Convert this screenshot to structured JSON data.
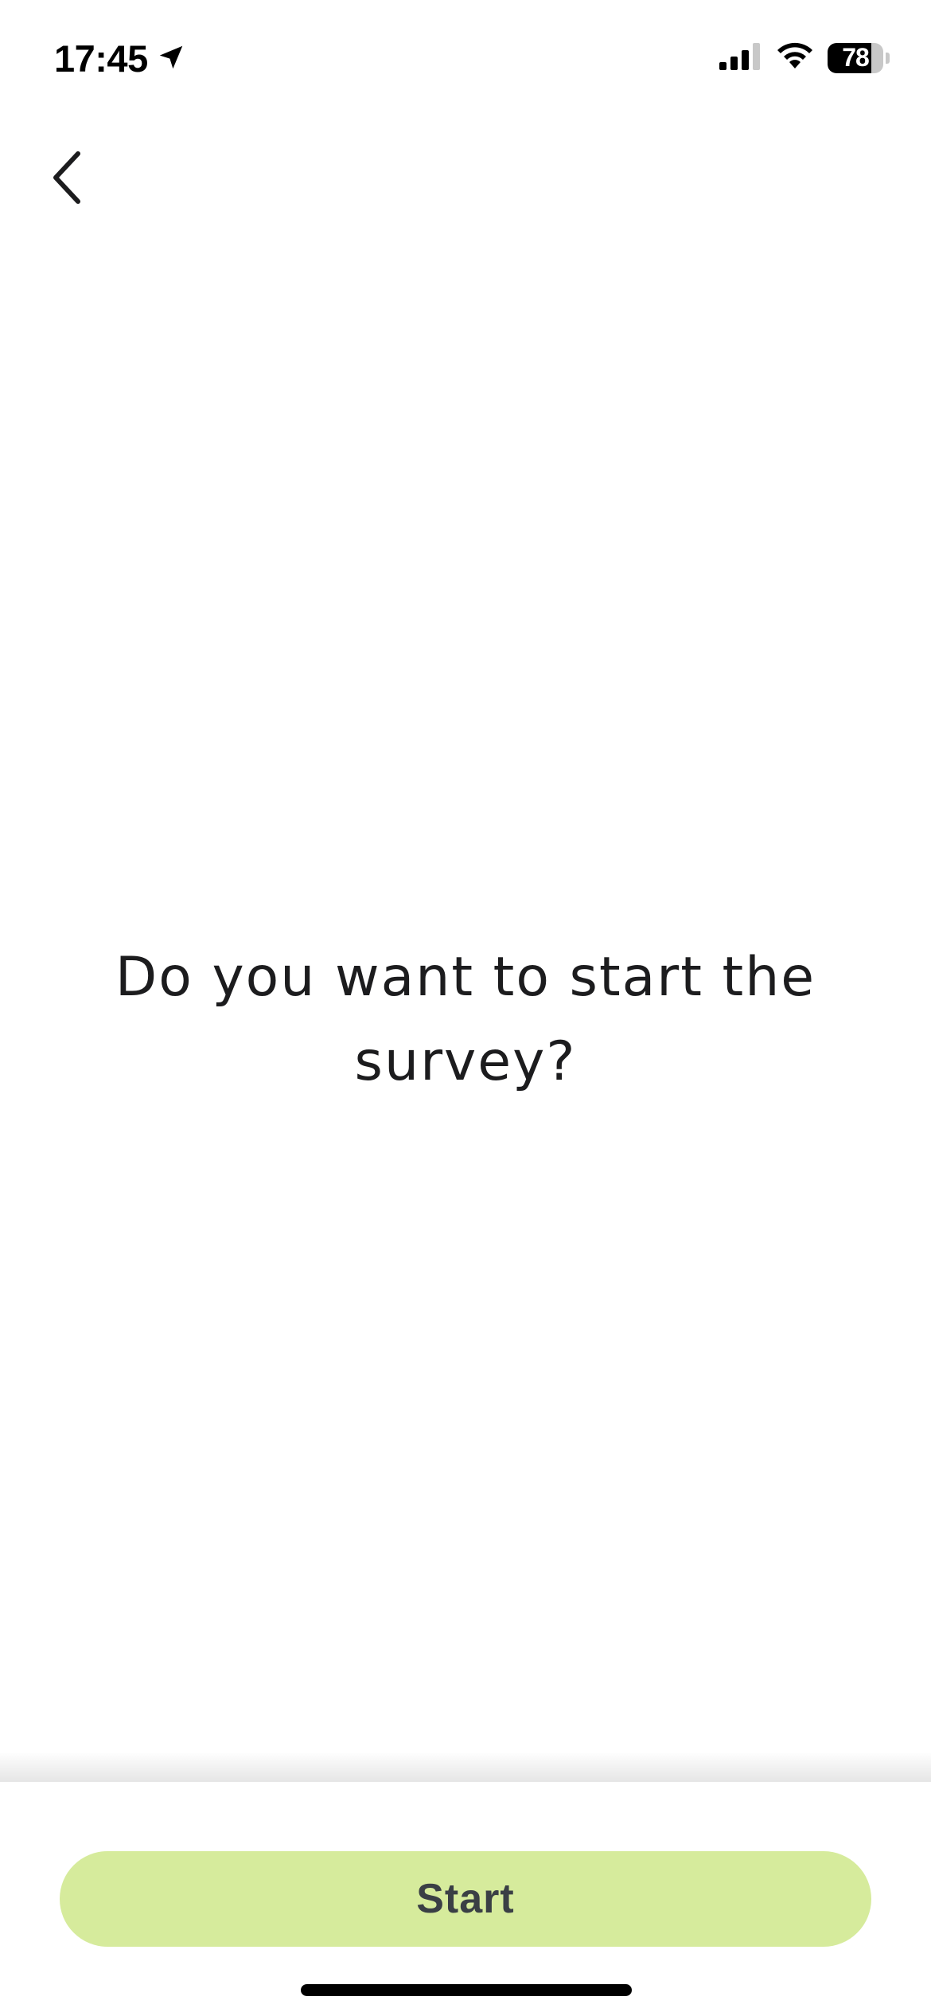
{
  "status_bar": {
    "time": "17:45",
    "battery_level": "78",
    "battery_fraction": 0.78,
    "signal_bars": 3,
    "icons": [
      "location-arrow-icon",
      "cellular-signal-icon",
      "wifi-icon",
      "battery-icon"
    ]
  },
  "navigation": {
    "back_icon": "chevron-left-icon"
  },
  "content": {
    "prompt": "Do you want to start the survey?"
  },
  "footer": {
    "start_label": "Start"
  },
  "colors": {
    "start_button_bg": "#d6eb9c",
    "start_button_text": "#3a3f45",
    "text_primary": "#1c1c1e",
    "background": "#ffffff"
  }
}
